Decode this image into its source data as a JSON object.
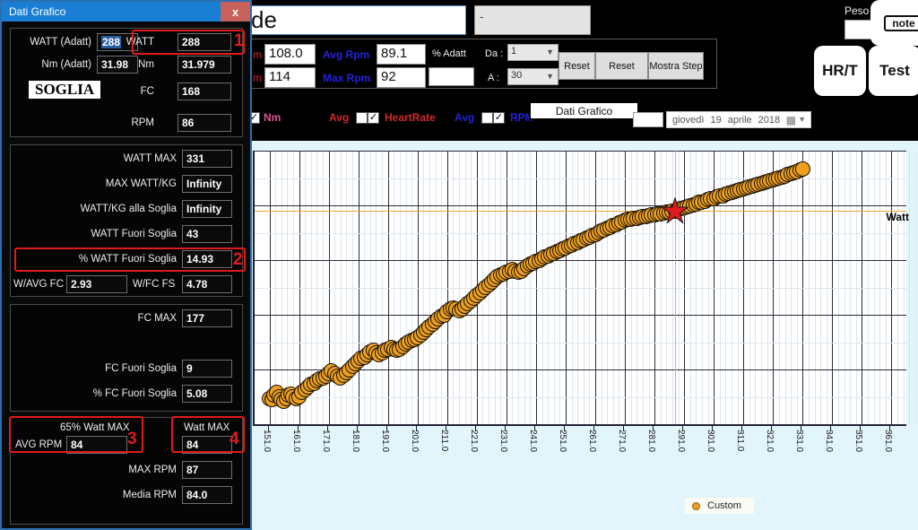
{
  "dialog": {
    "title": "Dati Grafico",
    "close_label": "x",
    "soglia_label": "SOGLIA",
    "section1": {
      "watt_adatt_label": "WATT (Adatt)",
      "watt_adatt_value": "288",
      "nm_adatt_label": "Nm (Adatt)",
      "nm_adatt_value": "31.98",
      "watt_label": "WATT",
      "watt_value": "288",
      "nm_label": "Nm",
      "nm_value": "31.979",
      "fc_label": "FC",
      "fc_value": "168",
      "rpm_label": "RPM",
      "rpm_value": "86",
      "marker": "1"
    },
    "section2": {
      "watt_max_label": "WATT MAX",
      "watt_max_value": "331",
      "max_watt_kg_label": "MAX WATT/KG",
      "max_watt_kg_value": "Infinity",
      "watt_kg_soglia_label": "WATT/KG alla Soglia",
      "watt_kg_soglia_value": "Infinity",
      "watt_fuori_soglia_label": "WATT Fuori Soglia",
      "watt_fuori_soglia_value": "43",
      "pct_watt_fuori_soglia_label": "% WATT Fuori Soglia",
      "pct_watt_fuori_soglia_value": "14.93",
      "w_avg_fc_label": "W/AVG FC",
      "w_avg_fc_value": "2.93",
      "w_fc_fs_label": "W/FC FS",
      "w_fc_fs_value": "4.78",
      "marker": "2"
    },
    "section3": {
      "fc_max_label": "FC MAX",
      "fc_max_value": "177",
      "fc_fuori_soglia_label": "FC Fuori Soglia",
      "fc_fuori_soglia_value": "9",
      "pct_fc_fuori_soglia_label": "% FC Fuori Soglia",
      "pct_fc_fuori_soglia_value": "5.08"
    },
    "section4": {
      "pct65_watt_max_label": "65% Watt MAX",
      "avg_rpm_label": "AVG RPM",
      "avg_rpm_value": "84",
      "watt_max_label": "Watt MAX",
      "watt_max_value": "84",
      "max_rpm_label": "MAX RPM",
      "max_rpm_value": "87",
      "media_rpm_label": "Media RPM",
      "media_rpm_value": "84.0",
      "marker3": "3",
      "marker4": "4"
    }
  },
  "toolbar": {
    "name_value": "de",
    "dash_value": "-",
    "peso_label": "Peso",
    "peso_value": "",
    "avg_bpm_label": "m",
    "avg_bpm_value": "108.0",
    "max_bpm_label": "m",
    "max_bpm_value": "114",
    "avg_rpm_label": "Avg Rpm",
    "avg_rpm_value": "89.1",
    "max_rpm_label": "Max Rpm",
    "max_rpm_value": "92",
    "pct_adatt_label": "% Adatt",
    "pct_adatt_value": "",
    "da_label": "Da :",
    "da_value": "1",
    "a_label": "A :",
    "a_value": "30",
    "reset1_label": "Reset",
    "reset2_label": "Reset",
    "mostra_step_label": "Mostra Step",
    "note_label": "note",
    "hrt_label": "HR/T",
    "test_label": "Test"
  },
  "checkrow": {
    "nm_label": "Nm",
    "avg_hr_label": "Avg",
    "heartrate_label": "HeartRate",
    "avg_rpm_label": "Avg",
    "rpm_label": "RPM",
    "dati_grafico_button": "Dati Grafico",
    "date_box_value": "",
    "date_weekday": "giovedì",
    "date_day": "19",
    "date_month": "aprile",
    "date_year": "2018",
    "calendar_icon": "▦",
    "chevron": "▼",
    "check_glyph": "✓"
  },
  "colors": {
    "accent_blue": "#1a7fd4",
    "marker_orange": "#eda020",
    "highlight_red": "#e01b1b",
    "crosshair_orange": "#f0a830",
    "plot_bg": "#ffffff",
    "chart_panel_bg": "#e2f5fb"
  },
  "chart_data": {
    "type": "scatter",
    "title": "",
    "xlabel": "Watt",
    "ylabel": "",
    "xlim": [
      146,
      366
    ],
    "ylim": [
      0,
      100
    ],
    "grid": true,
    "legend_position": "bottom",
    "xticks": [
      "151.0",
      "161.0",
      "171.0",
      "181.0",
      "191.0",
      "201.0",
      "211.0",
      "221.0",
      "231.0",
      "241.0",
      "251.0",
      "261.0",
      "271.0",
      "281.0",
      "291.0",
      "301.0",
      "311.0",
      "321.0",
      "331.0",
      "341.0",
      "351.0",
      "361.0"
    ],
    "series": [
      {
        "name": "Custom",
        "color": "#eda020",
        "points": [
          [
            151.0,
            9.5
          ],
          [
            152.0,
            9.0
          ],
          [
            152.6,
            10.5
          ],
          [
            153.4,
            11.5
          ],
          [
            154.2,
            10.0
          ],
          [
            155.0,
            9.0
          ],
          [
            155.8,
            8.5
          ],
          [
            156.6,
            9.5
          ],
          [
            157.4,
            10.5
          ],
          [
            158.2,
            11.0
          ],
          [
            159.0,
            10.0
          ],
          [
            160.0,
            9.5
          ],
          [
            161.0,
            10.0
          ],
          [
            162.0,
            11.5
          ],
          [
            163.0,
            12.5
          ],
          [
            164.0,
            13.5
          ],
          [
            165.0,
            14.5
          ],
          [
            166.0,
            15.0
          ],
          [
            167.0,
            16.0
          ],
          [
            168.0,
            16.5
          ],
          [
            169.0,
            17.0
          ],
          [
            170.0,
            17.5
          ],
          [
            171.0,
            18.5
          ],
          [
            172.0,
            19.5
          ],
          [
            173.0,
            18.5
          ],
          [
            174.0,
            17.5
          ],
          [
            175.0,
            17.0
          ],
          [
            176.0,
            18.0
          ],
          [
            177.0,
            19.0
          ],
          [
            178.0,
            20.0
          ],
          [
            179.0,
            21.0
          ],
          [
            180.0,
            22.0
          ],
          [
            181.0,
            23.0
          ],
          [
            182.0,
            24.0
          ],
          [
            183.0,
            24.5
          ],
          [
            184.0,
            25.5
          ],
          [
            185.0,
            26.5
          ],
          [
            186.0,
            27.0
          ],
          [
            187.0,
            26.0
          ],
          [
            188.0,
            25.5
          ],
          [
            189.0,
            26.0
          ],
          [
            190.0,
            27.0
          ],
          [
            191.0,
            27.5
          ],
          [
            192.0,
            28.0
          ],
          [
            193.0,
            27.5
          ],
          [
            194.0,
            27.0
          ],
          [
            195.0,
            27.5
          ],
          [
            196.0,
            28.5
          ],
          [
            197.0,
            29.5
          ],
          [
            198.0,
            30.0
          ],
          [
            199.0,
            30.5
          ],
          [
            200.0,
            31.0
          ],
          [
            201.0,
            31.5
          ],
          [
            202.0,
            32.5
          ],
          [
            203.0,
            33.5
          ],
          [
            204.0,
            34.5
          ],
          [
            205.0,
            35.5
          ],
          [
            206.0,
            36.5
          ],
          [
            207.0,
            37.5
          ],
          [
            208.0,
            38.5
          ],
          [
            209.0,
            39.5
          ],
          [
            210.0,
            40.0
          ],
          [
            211.0,
            41.0
          ],
          [
            212.0,
            42.0
          ],
          [
            213.0,
            42.5
          ],
          [
            214.0,
            42.0
          ],
          [
            215.0,
            41.5
          ],
          [
            216.0,
            42.0
          ],
          [
            217.0,
            43.0
          ],
          [
            218.0,
            44.0
          ],
          [
            219.0,
            45.0
          ],
          [
            220.0,
            46.0
          ],
          [
            221.0,
            47.0
          ],
          [
            222.0,
            48.0
          ],
          [
            223.0,
            49.0
          ],
          [
            224.0,
            50.0
          ],
          [
            225.0,
            51.0
          ],
          [
            226.0,
            52.0
          ],
          [
            227.0,
            53.0
          ],
          [
            228.0,
            54.0
          ],
          [
            229.0,
            54.5
          ],
          [
            230.0,
            55.0
          ],
          [
            231.0,
            55.5
          ],
          [
            232.0,
            56.0
          ],
          [
            233.0,
            56.5
          ],
          [
            234.0,
            56.0
          ],
          [
            235.0,
            55.5
          ],
          [
            236.0,
            56.0
          ],
          [
            237.0,
            57.0
          ],
          [
            238.0,
            58.0
          ],
          [
            239.0,
            58.5
          ],
          [
            240.0,
            59.0
          ],
          [
            241.0,
            59.5
          ],
          [
            242.0,
            60.0
          ],
          [
            243.0,
            60.5
          ],
          [
            244.0,
            61.0
          ],
          [
            245.0,
            61.5
          ],
          [
            246.0,
            62.0
          ],
          [
            247.0,
            62.5
          ],
          [
            248.0,
            63.0
          ],
          [
            249.0,
            63.5
          ],
          [
            250.0,
            64.0
          ],
          [
            251.0,
            64.5
          ],
          [
            252.0,
            65.0
          ],
          [
            253.0,
            65.5
          ],
          [
            254.0,
            66.0
          ],
          [
            255.0,
            66.5
          ],
          [
            256.0,
            67.0
          ],
          [
            257.0,
            67.5
          ],
          [
            258.0,
            68.0
          ],
          [
            259.0,
            68.5
          ],
          [
            260.0,
            69.0
          ],
          [
            261.0,
            69.5
          ],
          [
            262.0,
            70.0
          ],
          [
            263.0,
            70.5
          ],
          [
            264.0,
            71.0
          ],
          [
            265.0,
            71.5
          ],
          [
            266.0,
            72.0
          ],
          [
            267.0,
            72.5
          ],
          [
            268.0,
            73.0
          ],
          [
            269.0,
            73.5
          ],
          [
            270.0,
            74.0
          ],
          [
            271.0,
            74.5
          ],
          [
            272.0,
            75.0
          ],
          [
            273.0,
            75.0
          ],
          [
            274.0,
            75.2
          ],
          [
            275.0,
            75.4
          ],
          [
            276.0,
            75.6
          ],
          [
            277.0,
            75.8
          ],
          [
            278.0,
            76.0
          ],
          [
            279.0,
            76.2
          ],
          [
            280.0,
            76.4
          ],
          [
            281.0,
            76.6
          ],
          [
            282.0,
            76.8
          ],
          [
            283.0,
            77.0
          ],
          [
            284.0,
            77.2
          ],
          [
            285.0,
            77.4
          ],
          [
            286.0,
            77.6
          ],
          [
            287.0,
            77.8
          ],
          [
            288.0,
            78.0
          ],
          [
            289.0,
            78.5
          ],
          [
            290.0,
            79.0
          ],
          [
            291.0,
            79.3
          ],
          [
            292.0,
            79.6
          ],
          [
            293.0,
            80.0
          ],
          [
            294.0,
            80.3
          ],
          [
            295.0,
            80.6
          ],
          [
            296.0,
            81.0
          ],
          [
            297.0,
            81.3
          ],
          [
            298.0,
            81.6
          ],
          [
            299.0,
            82.0
          ],
          [
            300.0,
            82.3
          ],
          [
            301.0,
            82.6
          ],
          [
            302.0,
            83.0
          ],
          [
            303.0,
            83.3
          ],
          [
            304.0,
            83.6
          ],
          [
            305.0,
            84.0
          ],
          [
            306.0,
            84.3
          ],
          [
            307.0,
            84.6
          ],
          [
            308.0,
            85.0
          ],
          [
            309.0,
            85.3
          ],
          [
            310.0,
            85.6
          ],
          [
            311.0,
            86.0
          ],
          [
            312.0,
            86.3
          ],
          [
            313.0,
            86.6
          ],
          [
            314.0,
            87.0
          ],
          [
            315.0,
            87.3
          ],
          [
            316.0,
            87.6
          ],
          [
            317.0,
            88.0
          ],
          [
            318.0,
            88.3
          ],
          [
            319.0,
            88.6
          ],
          [
            320.0,
            89.0
          ],
          [
            321.0,
            89.3
          ],
          [
            322.0,
            89.6
          ],
          [
            323.0,
            90.0
          ],
          [
            324.0,
            90.4
          ],
          [
            325.0,
            90.8
          ],
          [
            326.0,
            91.2
          ],
          [
            327.0,
            91.6
          ],
          [
            328.0,
            92.0
          ],
          [
            329.0,
            92.4
          ],
          [
            330.0,
            92.8
          ],
          [
            331.0,
            93.2
          ]
        ]
      }
    ],
    "annotations": {
      "crosshair_x": 288,
      "crosshair_y": 78,
      "threshold_marker": {
        "shape": "star",
        "color": "#e01b1b",
        "x": 288,
        "y": 78,
        "label": "SOGLIA"
      },
      "threshold_line_y": 78
    },
    "legend": [
      {
        "label": "Custom",
        "color": "#eda020"
      }
    ]
  }
}
